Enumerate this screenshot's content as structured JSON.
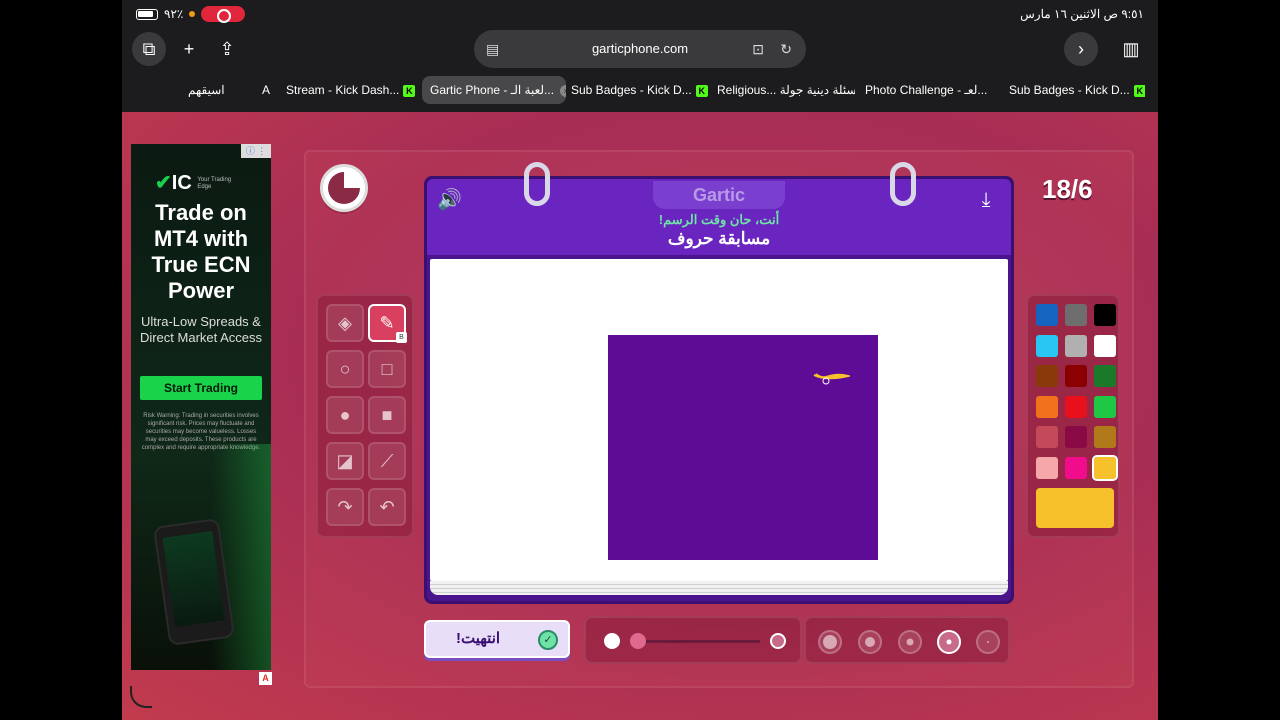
{
  "status_bar": {
    "time_date": "٩:٥١ ص  الاثنين ١٦ مارس",
    "battery": "٩٢٪"
  },
  "browser": {
    "url": "garticphone.com",
    "tabs": [
      {
        "label": "اسيقهم",
        "prefix": "A"
      },
      {
        "label": "Stream - Kick Dash..."
      },
      {
        "label": "Gartic Phone - لعبة الـ...",
        "active": true
      },
      {
        "label": "Sub Badges - Kick D..."
      },
      {
        "label": "Religious... أسئلة دينية جولة"
      },
      {
        "label": "Photo Challenge - لعـ..."
      },
      {
        "label": "Sub Badges - Kick D..."
      }
    ]
  },
  "ad": {
    "brand": "IC",
    "tagline": "Your Trading Edge",
    "headline": "Trade on MT4 with True ECN Power",
    "subtext": "Ultra-Low Spreads & Direct Market Access",
    "cta": "Start Trading",
    "risk": "Risk Warning: Trading in securities involves significant risk. Prices may fluctuate and securities may become valueless. Losses may exceed deposits. These products are complex and require appropriate knowledge.",
    "marker": "A"
  },
  "game": {
    "round": "18/6",
    "brand": "Gartic",
    "instruction": "أنت، حان وقت الرسم!",
    "prompt": "مسابقة حروف",
    "done_label": "انتهيت!",
    "pen_shortcut": "B",
    "timer_remaining_fraction": 0.75
  },
  "colors": {
    "palette": [
      "#1565c0",
      "#6e6e6e",
      "#000000",
      "#29c6f3",
      "#b0b0b0",
      "#ffffff",
      "#8a3a0a",
      "#8b0000",
      "#1a7a2a",
      "#f2711c",
      "#e8101c",
      "#1ec744",
      "#c44a5a",
      "#8a0a45",
      "#b07a1a",
      "#f6a7a7",
      "#f00c8c",
      "#f6c12a"
    ],
    "selected": "#f6c12a",
    "canvas_fill": "#5e0b95"
  }
}
